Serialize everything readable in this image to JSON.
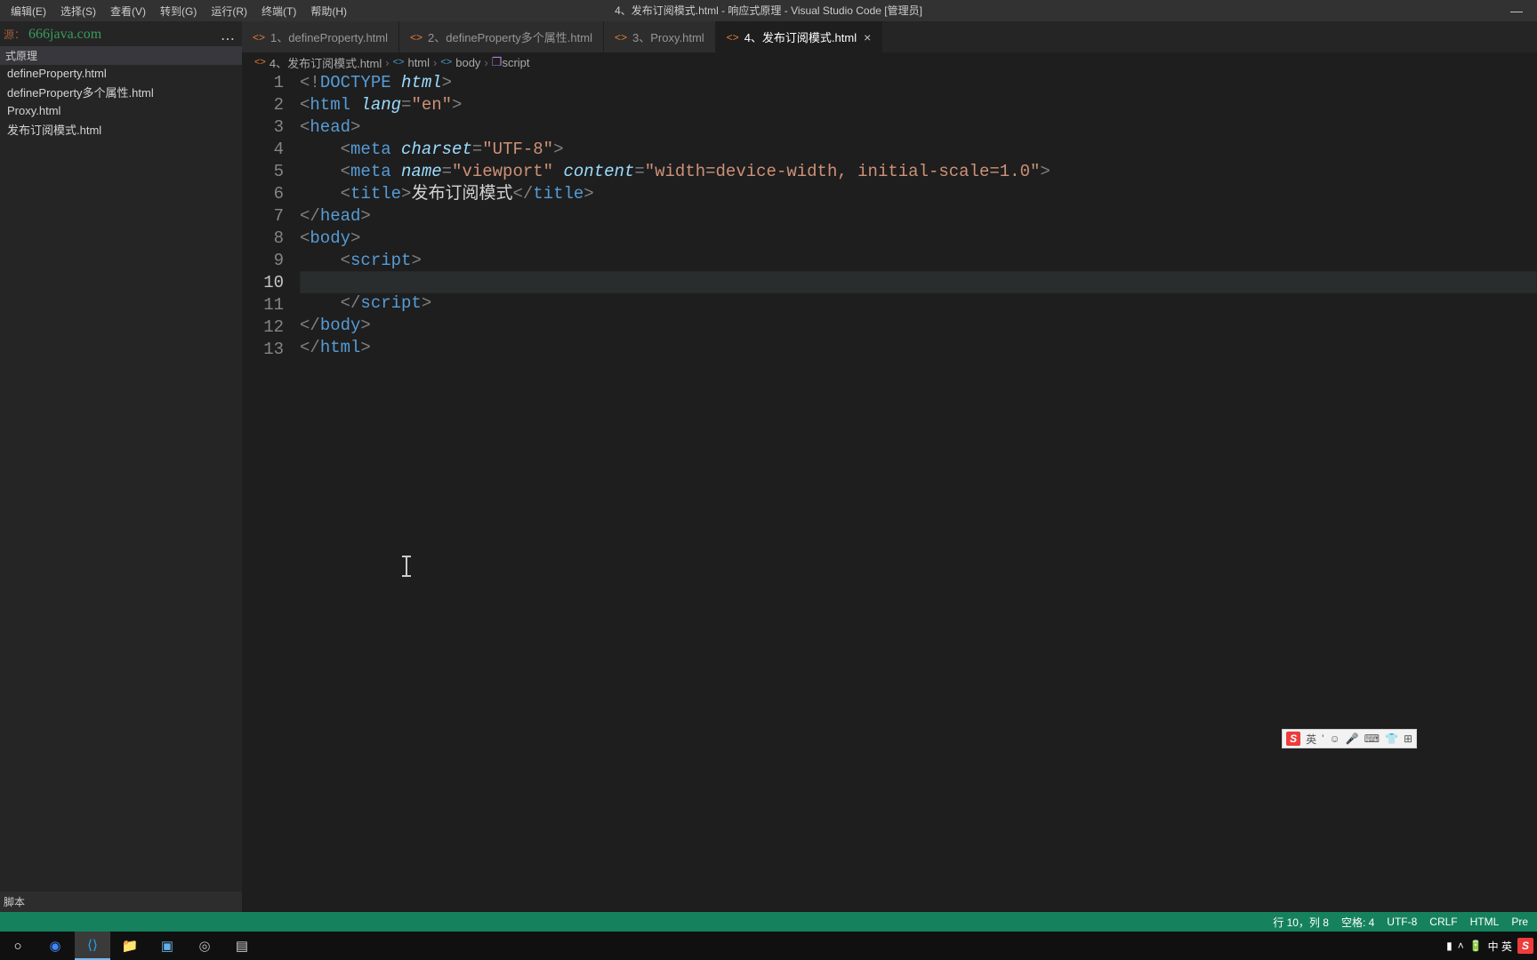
{
  "menu": {
    "items": [
      "编辑(E)",
      "选择(S)",
      "查看(V)",
      "转到(G)",
      "运行(R)",
      "终端(T)",
      "帮助(H)"
    ]
  },
  "window": {
    "title": "4、发布订阅模式.html - 响应式原理 - Visual Studio Code [管理员]"
  },
  "sidebar": {
    "watermark_prefix": "源：",
    "watermark": "666java.com",
    "section": "式原理",
    "files": [
      "defineProperty.html",
      "defineProperty多个属性.html",
      "Proxy.html",
      "发布订阅模式.html"
    ],
    "bottom_label": "脚本"
  },
  "tabs": [
    {
      "label": "1、defineProperty.html",
      "active": false
    },
    {
      "label": "2、defineProperty多个属性.html",
      "active": false
    },
    {
      "label": "3、Proxy.html",
      "active": false
    },
    {
      "label": "4、发布订阅模式.html",
      "active": true
    }
  ],
  "breadcrumb": {
    "segments": [
      "4、发布订阅模式.html",
      "html",
      "body",
      "script"
    ]
  },
  "code": {
    "lines": [
      {
        "n": 1,
        "html": "<span class='t-punct'>&lt;!</span><span class='t-doctype'>DOCTYPE</span> <span class='t-attr'>html</span><span class='t-punct'>&gt;</span>"
      },
      {
        "n": 2,
        "html": "<span class='t-punct'>&lt;</span><span class='t-tag'>html</span> <span class='t-attr'>lang</span><span class='t-punct'>=</span><span class='t-str'>\"en\"</span><span class='t-punct'>&gt;</span>"
      },
      {
        "n": 3,
        "html": "<span class='t-punct'>&lt;</span><span class='t-tag'>head</span><span class='t-punct'>&gt;</span>"
      },
      {
        "n": 4,
        "html": "    <span class='t-punct'>&lt;</span><span class='t-tag'>meta</span> <span class='t-attr'>charset</span><span class='t-punct'>=</span><span class='t-str'>\"UTF-8\"</span><span class='t-punct'>&gt;</span>"
      },
      {
        "n": 5,
        "html": "    <span class='t-punct'>&lt;</span><span class='t-tag'>meta</span> <span class='t-attr'>name</span><span class='t-punct'>=</span><span class='t-str'>\"viewport\"</span> <span class='t-attr'>content</span><span class='t-punct'>=</span><span class='t-str'>\"width=device-width, initial-scale=1.0\"</span><span class='t-punct'>&gt;</span>"
      },
      {
        "n": 6,
        "html": "    <span class='t-punct'>&lt;</span><span class='t-tag'>title</span><span class='t-punct'>&gt;</span><span class='t-text'>发布订阅模式</span><span class='t-punct'>&lt;/</span><span class='t-tag'>title</span><span class='t-punct'>&gt;</span>"
      },
      {
        "n": 7,
        "html": "<span class='t-punct'>&lt;/</span><span class='t-tag'>head</span><span class='t-punct'>&gt;</span>"
      },
      {
        "n": 8,
        "html": "<span class='t-punct'>&lt;</span><span class='t-tag'>body</span><span class='t-punct'>&gt;</span>"
      },
      {
        "n": 9,
        "html": "    <span class='t-punct'>&lt;</span><span class='t-tag'>script</span><span class='t-punct'>&gt;</span>"
      },
      {
        "n": 10,
        "html": "        ",
        "active": true
      },
      {
        "n": 11,
        "html": "    <span class='t-punct'>&lt;/</span><span class='t-tag'>script</span><span class='t-punct'>&gt;</span>"
      },
      {
        "n": 12,
        "html": "<span class='t-punct'>&lt;/</span><span class='t-tag'>body</span><span class='t-punct'>&gt;</span>"
      },
      {
        "n": 13,
        "html": "<span class='t-punct'>&lt;/</span><span class='t-tag'>html</span><span class='t-punct'>&gt;</span>"
      }
    ]
  },
  "statusbar": {
    "ln_col": "行 10，列 8",
    "spaces": "空格: 4",
    "encoding": "UTF-8",
    "eol": "CRLF",
    "lang": "HTML",
    "pre": "Pre"
  },
  "ime": {
    "lang": "英",
    "icons": "☺ 🎤 ⌨ 🖨 👕 ⊞"
  },
  "taskbar": {
    "right_text": "中 英"
  }
}
